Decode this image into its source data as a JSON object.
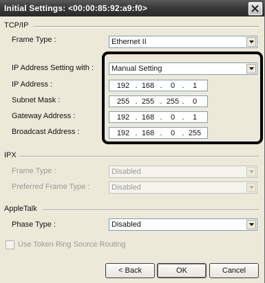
{
  "window": {
    "title": "Initial Settings: <00:00:85:92:a9:f0>"
  },
  "tcpip": {
    "section_label": "TCP/IP",
    "frame_type": {
      "label": "Frame Type :",
      "value": "Ethernet II"
    },
    "ip_setting": {
      "label": "IP Address Setting with :",
      "value": "Manual Setting"
    },
    "ip_address": {
      "label": "IP Address :",
      "octets": [
        "192",
        "168",
        "0",
        "1"
      ]
    },
    "subnet_mask": {
      "label": "Subnet Mask :",
      "octets": [
        "255",
        "255",
        "255",
        "0"
      ]
    },
    "gateway": {
      "label": "Gateway Address :",
      "octets": [
        "192",
        "168",
        "0",
        "1"
      ]
    },
    "broadcast": {
      "label": "Broadcast Address :",
      "octets": [
        "192",
        "168",
        "0",
        "255"
      ]
    }
  },
  "ipx": {
    "section_label": "IPX",
    "frame_type": {
      "label": "Frame Type :",
      "value": "Disabled"
    },
    "preferred_frame_type": {
      "label": "Preferred Frame Type :",
      "value": "Disabled"
    }
  },
  "appletalk": {
    "section_label": "AppleTalk",
    "phase_type": {
      "label": "Phase Type :",
      "value": "Disabled"
    }
  },
  "token_ring": {
    "label": "Use Token Ring Source Routing"
  },
  "buttons": {
    "back": "< Back",
    "ok": "OK",
    "cancel": "Cancel"
  },
  "colors": {
    "titlebar": "#3a3a3a",
    "dialog_bg": "#ece9d8",
    "highlight": "#000000"
  }
}
